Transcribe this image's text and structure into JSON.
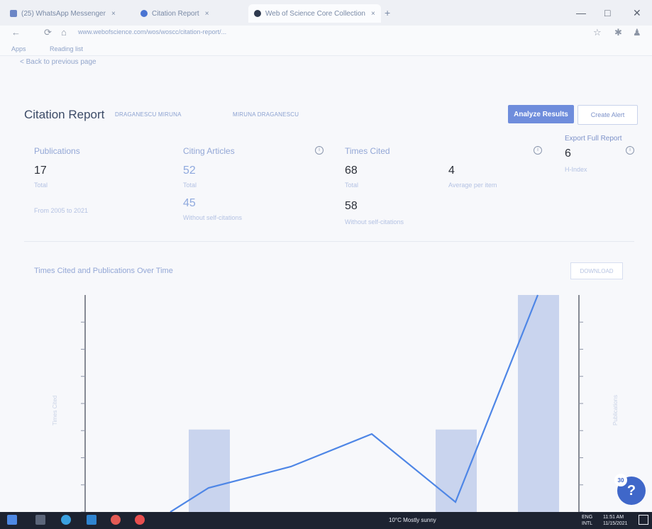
{
  "browser": {
    "tabs": [
      {
        "label": "(25) WhatsApp Messenger",
        "close": "×"
      },
      {
        "label": "Citation Report",
        "close": "×"
      },
      {
        "label": "Web of Science Core Collection",
        "close": "×"
      }
    ],
    "new_tab": "+",
    "address": "www.webofscience.com/wos/woscc/citation-report/...",
    "bookmarks": [
      "Apps",
      "Reading list"
    ],
    "window_controls": [
      "—",
      "□",
      "✕"
    ]
  },
  "page": {
    "back_link": "< Back to previous page",
    "title": "Citation Report",
    "subtitle_1": "DRAGANESCU MIRUNA",
    "subtitle_2": "MIRUNA DRAGANESCU",
    "analyze_button": "Analyze Results",
    "create_alert_button": "Create Alert",
    "export_link": "Export Full Report"
  },
  "metrics": {
    "publications": {
      "label": "Publications",
      "value": "17",
      "sub": "Total",
      "range": "From 2005 to 2021"
    },
    "citing_articles": {
      "label": "Citing Articles",
      "value_total": "52",
      "sub_total": "Total",
      "value_without": "45",
      "sub_without": "Without self-citations"
    },
    "times_cited": {
      "label": "Times Cited",
      "value_total": "68",
      "sub_total": "Total",
      "value_without": "58",
      "sub_without": "Without self-citations"
    },
    "average": {
      "value": "4",
      "sub": "Average per item"
    },
    "h_index": {
      "value": "6",
      "sub": "H-Index"
    }
  },
  "chart_section": {
    "title": "Times Cited and Publications Over Time",
    "dropdown": "DOWNLOAD"
  },
  "chart_data": {
    "type": "bar+line",
    "bars_points": [
      0.38,
      0.38,
      1.0
    ],
    "line_points": [
      0.0,
      0.12,
      0.22,
      0.35,
      0.0,
      1.0
    ],
    "left_axis_label": "Times Cited",
    "right_axis_label": "Publications"
  },
  "taskbar": {
    "weather": "10°C  Mostly sunny",
    "language": "ENG",
    "time": "11:51 AM",
    "date": "11/15/2021",
    "region": "INTL"
  },
  "help": {
    "label": "?",
    "badge": "30"
  }
}
